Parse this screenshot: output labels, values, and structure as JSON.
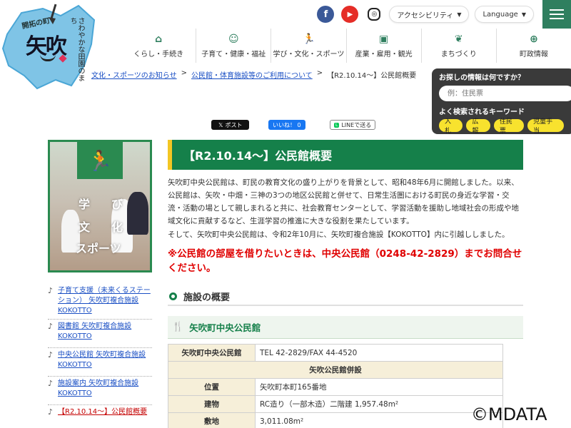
{
  "logo": {
    "town_name": "矢吹",
    "tagline_top": "開拓の町",
    "tagline_side": "さわやかな田園のまち"
  },
  "header": {
    "sns": [
      {
        "name": "facebook",
        "glyph": "f",
        "color": "#3b5998"
      },
      {
        "name": "youtube",
        "glyph": "▶",
        "color": "#e52d27"
      },
      {
        "name": "instagram",
        "glyph": "◎",
        "color": "#222222"
      }
    ],
    "accessibility_label": "アクセシビリティ",
    "language_label": "Language",
    "menu_icon": "hamburger-icon"
  },
  "nav": [
    {
      "icon": "house-icon",
      "glyph": "⌂",
      "label": "くらし・手続き"
    },
    {
      "icon": "baby-icon",
      "glyph": "☺",
      "label": "子育て・健康・福祉"
    },
    {
      "icon": "runner-icon",
      "glyph": "🏃",
      "label": "学び・文化・スポーツ"
    },
    {
      "icon": "briefcase-icon",
      "glyph": "▣",
      "label": "産業・雇用・観光"
    },
    {
      "icon": "leaf-icon",
      "glyph": "❦",
      "label": "まちづくり"
    },
    {
      "icon": "globe-icon",
      "glyph": "⊕",
      "label": "町政情報"
    }
  ],
  "breadcrumb": {
    "home": "ホー",
    "section": "文化・スポーツのお知らせ",
    "parent": "公民館・体育施設等のご利用について",
    "current": "【R2.10.14～】公民館概要"
  },
  "search": {
    "question": "お探しの情報は何ですか？",
    "placeholder": "例：住民票",
    "keywords_title": "よく検索されるキーワード",
    "keywords": [
      "入札",
      "広報",
      "住民票",
      "児童手当"
    ]
  },
  "share": {
    "x_label": "ポスト",
    "like_label": "いいね！ 0",
    "line_label": "LINEで送る"
  },
  "sidebar": {
    "category_glyphs": [
      "学",
      "び",
      "文",
      "化",
      "スポーツ"
    ],
    "links": [
      {
        "label": "子育て支援（未来くるステーション） 矢吹町複合施設KOKOTTO",
        "active": false
      },
      {
        "label": "図書館 矢吹町複合施設KOKOTTO",
        "active": false
      },
      {
        "label": "中央公民館 矢吹町複合施設KOKOTTO",
        "active": false
      },
      {
        "label": "施設案内 矢吹町複合施設KOKOTTO",
        "active": false
      },
      {
        "label": "【R2.10.14～】公民館概要",
        "active": true
      }
    ]
  },
  "main": {
    "title": "【R2.10.14～】公民館概要",
    "paragraph1": "矢吹町中央公民館は、町民の教育文化の盛り上がりを背景として、昭和48年6月に開館しました。以来、公民館は、矢吹・中畑・三神の3つの地区公民館と併せて、日常生活圏における町民の身近な学習・交流・活動の場として親しまれると共に、社会教育センターとして、学習活動を援助し地域社会の形成や地域文化に貢献するなど、生涯学習の推進に大きな役割を果たしています。",
    "paragraph2": "そして、矢吹町中央公民館は、令和2年10月に、矢吹町複合施設【KOKOTTO】内に引越ししました。",
    "notice": "※公民館の部屋を借りたいときは、中央公民館（0248-42-2829）までお問合せください。",
    "section_title": "施設の概要",
    "subsection_title": "矢吹町中央公民館",
    "table": {
      "r1_th": "矢吹町中央公民館",
      "r1_td": "TEL 42-2829/FAX 44-4520",
      "r2_full": "矢吹公民館併設",
      "r3_th": "位置",
      "r3_td": "矢吹町本町165番地",
      "r4_th": "建物",
      "r4_td": "RC造り（一部木造）二階建 1,957.48m²",
      "r5_th": "敷地",
      "r5_td": "3,011.08m²"
    }
  },
  "watermark": "©MDATA"
}
